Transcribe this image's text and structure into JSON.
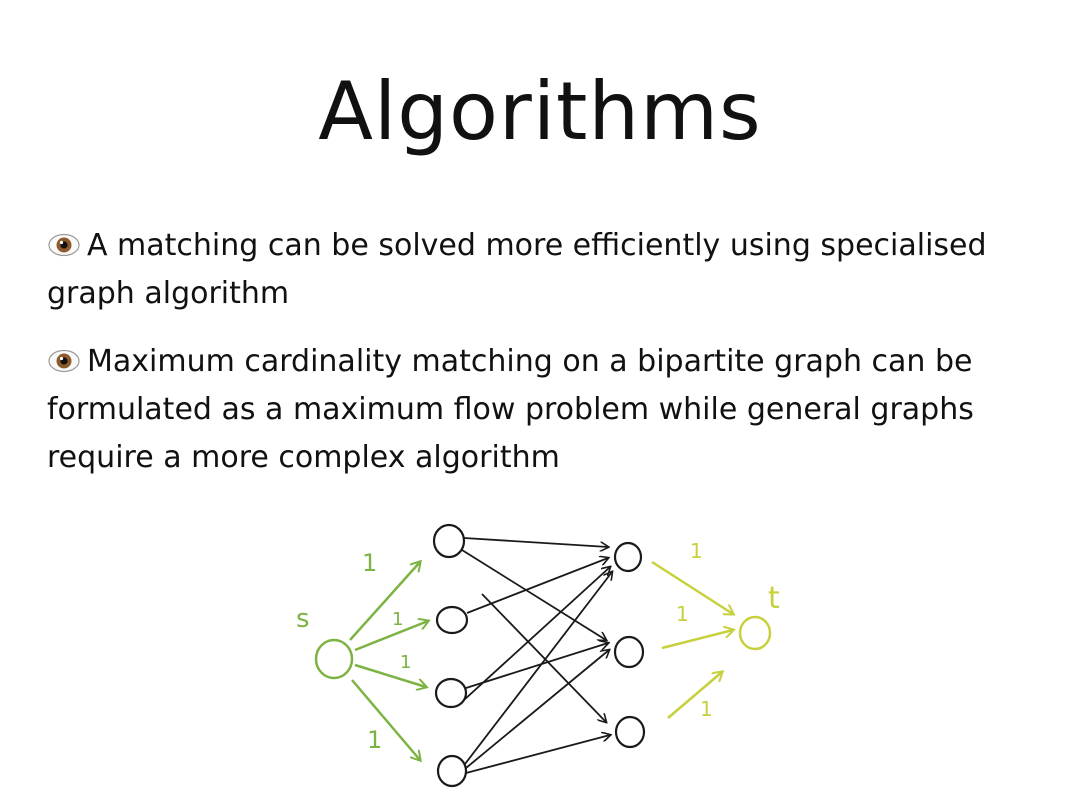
{
  "slide": {
    "title": "Algorithms",
    "bullets": [
      {
        "icon": "eye-icon",
        "text": "A matching can be solved more efficiently using specialised graph algorithm"
      },
      {
        "icon": "eye-icon",
        "text": "Maximum cardinality matching on a bipartite graph can be formulated as a maximum flow problem while general graphs require a more complex algorithm"
      }
    ]
  },
  "diagram": {
    "source_label": "s",
    "sink_label": "t",
    "source_edge_labels": [
      "1",
      "1",
      "1",
      "1"
    ],
    "sink_edge_labels": [
      "1",
      "1",
      "1"
    ],
    "colors": {
      "source_edges": "#7cb342",
      "sink_edges": "#c6d13c",
      "middle_edges": "#1a1a1a"
    }
  }
}
